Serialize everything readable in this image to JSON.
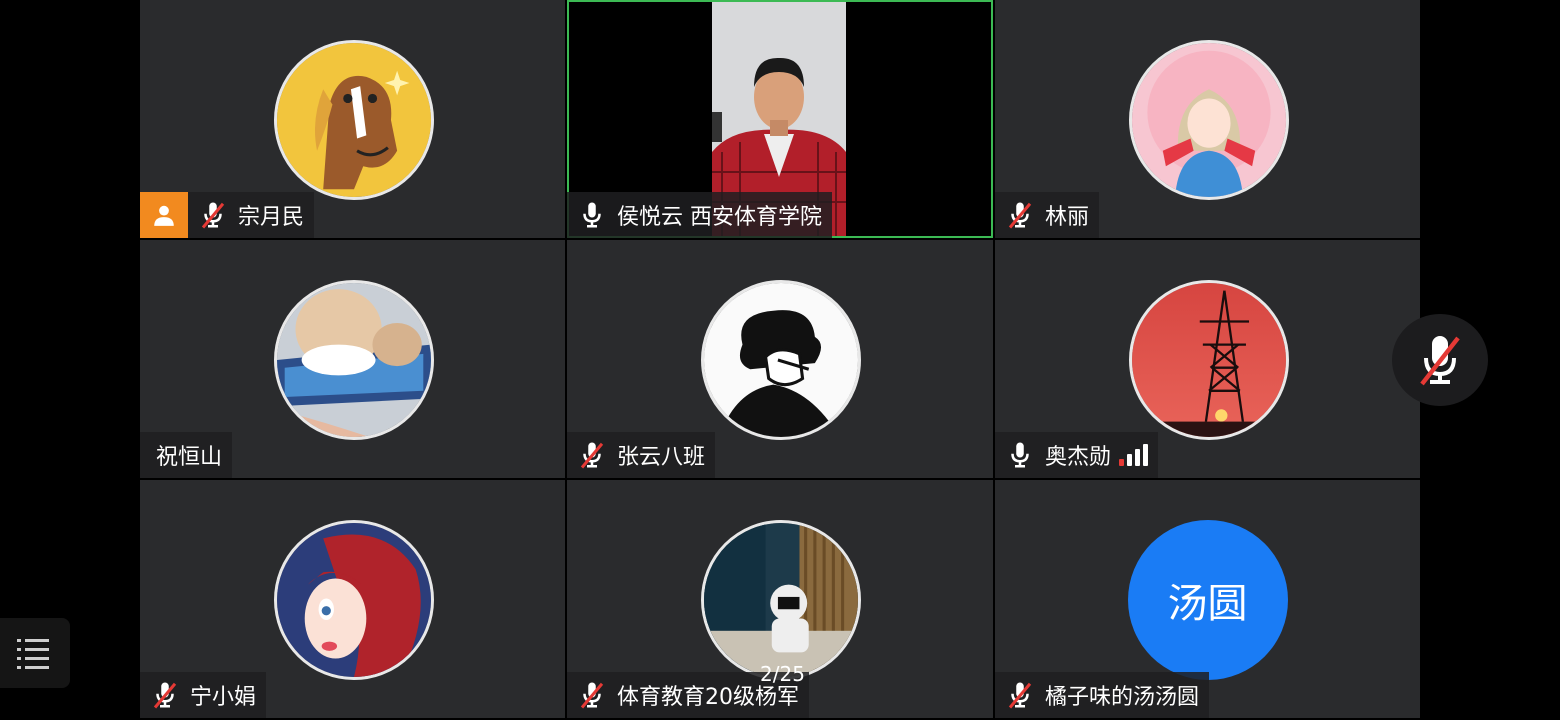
{
  "participants": [
    {
      "name": "宗月民",
      "mic": "muted",
      "host": true,
      "avatar": "horse-cartoon-avatar"
    },
    {
      "name": "侯悦云 西安体育学院",
      "mic": "on",
      "active_speaker": true,
      "video": "camera-feed"
    },
    {
      "name": "林丽",
      "mic": "muted",
      "avatar": "anime-girl-avatar"
    },
    {
      "name": "祝恒山",
      "mic": "none",
      "avatar": "cat-paws-avatar"
    },
    {
      "name": "张云八班",
      "mic": "muted",
      "avatar": "sketch-boy-avatar"
    },
    {
      "name": "奥杰勋",
      "mic": "on",
      "signal": "weak",
      "avatar": "power-tower-sunset-avatar"
    },
    {
      "name": "宁小娟",
      "mic": "muted",
      "avatar": "red-hair-cartoon-avatar"
    },
    {
      "name": "体育教育20级杨军",
      "mic": "muted",
      "avatar": "astronaut-avatar"
    },
    {
      "name": "橘子味的汤汤圆",
      "mic": "muted",
      "avatar_text": "汤圆",
      "avatar_color": "#1a7cf5"
    }
  ],
  "pagination": "2/25",
  "colors": {
    "host_badge": "#f28a1f",
    "active_border": "#3cba54",
    "muted_slash": "#e53935",
    "tile_bg": "#2a2b2d"
  }
}
